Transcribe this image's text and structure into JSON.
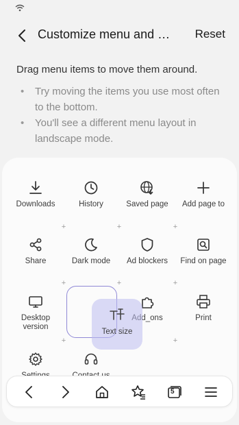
{
  "header": {
    "title": "Customize menu and …",
    "reset_label": "Reset"
  },
  "intro": "Drag menu items to move them around.",
  "tips": [
    "Try moving the items you use most often to the bottom.",
    "You'll see a different menu layout in landscape mode."
  ],
  "menu": {
    "items": [
      {
        "label": "Downloads",
        "icon": "download-icon"
      },
      {
        "label": "History",
        "icon": "clock-icon"
      },
      {
        "label": "Saved page",
        "icon": "globe-save-icon"
      },
      {
        "label": "Add page to",
        "icon": "plus-icon"
      },
      {
        "label": "Share",
        "icon": "share-icon"
      },
      {
        "label": "Dark mode",
        "icon": "moon-icon"
      },
      {
        "label": "Ad blockers",
        "icon": "shield-icon"
      },
      {
        "label": "Find on page",
        "icon": "find-icon"
      },
      {
        "label": "Desktop version",
        "icon": "desktop-icon"
      },
      {
        "label": "Add_ons",
        "icon": "puzzle-icon"
      },
      {
        "label": "Print",
        "icon": "printer-icon"
      },
      {
        "label": "Settings",
        "icon": "gear-icon"
      },
      {
        "label": "Contact us",
        "icon": "headset-icon"
      }
    ],
    "dragging": {
      "label": "Text size",
      "icon": "text-size-icon"
    }
  },
  "bottom_bar": {
    "tab_count": "5",
    "icons": [
      "back-icon",
      "forward-icon",
      "home-icon",
      "bookmarks-icon",
      "tabs-icon",
      "menu-icon"
    ]
  },
  "colors": {
    "background": "#f2f2f2",
    "panel": "#fbfbfb",
    "drag_highlight": "#beb9f0",
    "drop_outline": "#8f88d6"
  }
}
